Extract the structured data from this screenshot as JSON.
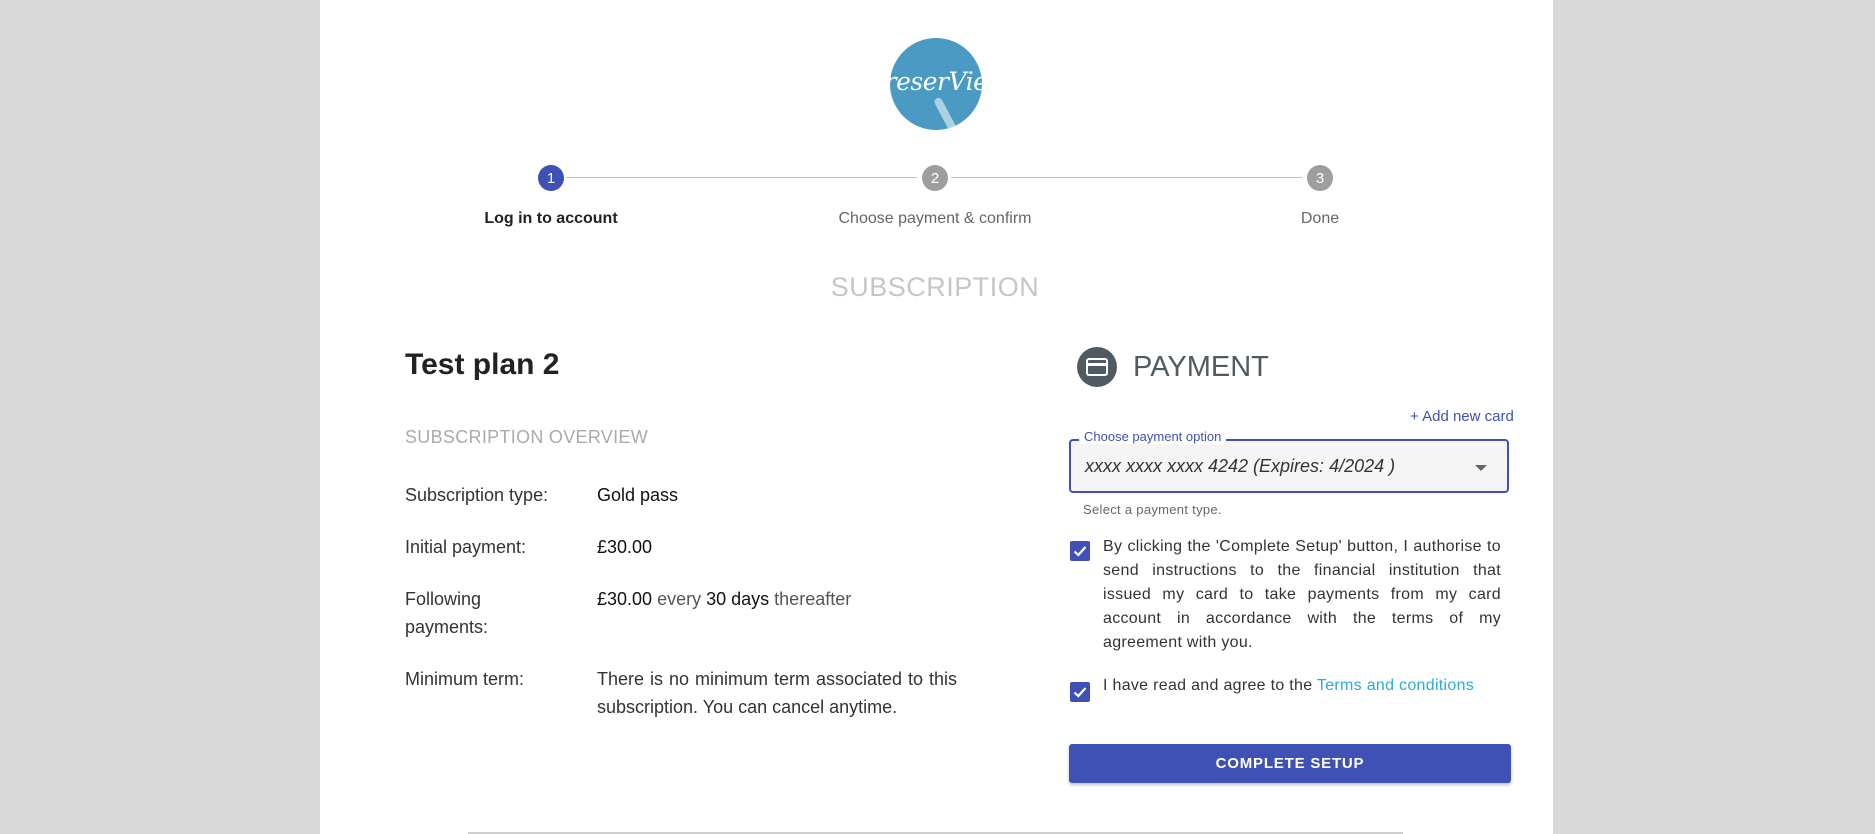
{
  "brand": {
    "logo_text": "reserVie"
  },
  "stepper": {
    "steps": [
      {
        "number": "1",
        "label": "Log in to account"
      },
      {
        "number": "2",
        "label": "Choose payment & confirm"
      },
      {
        "number": "3",
        "label": "Done"
      }
    ],
    "active_step": 1
  },
  "section_heading": "SUBSCRIPTION",
  "plan": {
    "title": "Test plan 2",
    "overview_title": "SUBSCRIPTION OVERVIEW",
    "rows": {
      "type_label": "Subscription type:",
      "type_value": "Gold pass",
      "initial_label": "Initial payment:",
      "initial_value": "£30.00",
      "following_label_line1": "Following",
      "following_label_line2": "payments:",
      "following_amount": "£30.00",
      "following_every": "every",
      "following_period": "30 days",
      "following_thereafter": "thereafter",
      "minimum_label": "Minimum term:",
      "minimum_value": "There is no minimum term associated to this subscription. You can cancel anytime."
    }
  },
  "payment": {
    "title": "PAYMENT",
    "icon": "credit-card-icon",
    "add_card": "+ Add new card",
    "select_label": "Choose payment option",
    "select_value": "xxxx xxxx xxxx 4242 (Expires: 4/2024 )",
    "select_help": "Select a payment type.",
    "authorise_text": "By clicking the 'Complete Setup' button, I authorise to send instructions to the financial institution that issued my card to take payments from my card account in accordance with the terms of my agreement with you.",
    "authorise_checked": true,
    "agree_text": "I have read and agree to the ",
    "agree_link": "Terms and conditions",
    "agree_checked": true,
    "submit_label": "COMPLETE SETUP"
  },
  "colors": {
    "primary": "#3f51b5",
    "link": "#29a9e1",
    "logo": "#4b9ac4",
    "muted": "#9e9e9e",
    "page_bg": "#d9d9d9"
  }
}
